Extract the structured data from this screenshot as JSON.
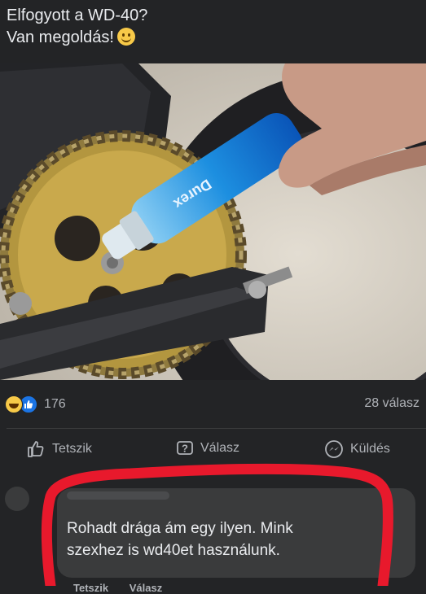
{
  "post": {
    "line1": "Elfogyott a WD-40?",
    "line2": "Van megoldás!",
    "emoji": "smiling-face-icon"
  },
  "photo": {
    "bottle_label": "Durex"
  },
  "stats": {
    "reaction_count": "176",
    "reply_count": "28 válasz"
  },
  "actions": {
    "like_label": "Tetszik",
    "reply_label": "Válasz",
    "send_label": "Küldés"
  },
  "comment": {
    "line1": "Rohadt drága ám egy ilyen. Mink",
    "line2": "szexhez is wd40et használunk.",
    "like_label": "Tetszik",
    "reply_label": "Válasz"
  },
  "colors": {
    "background": "#232426",
    "bubble": "#3a3b3c",
    "annotation": "#e8192c"
  }
}
